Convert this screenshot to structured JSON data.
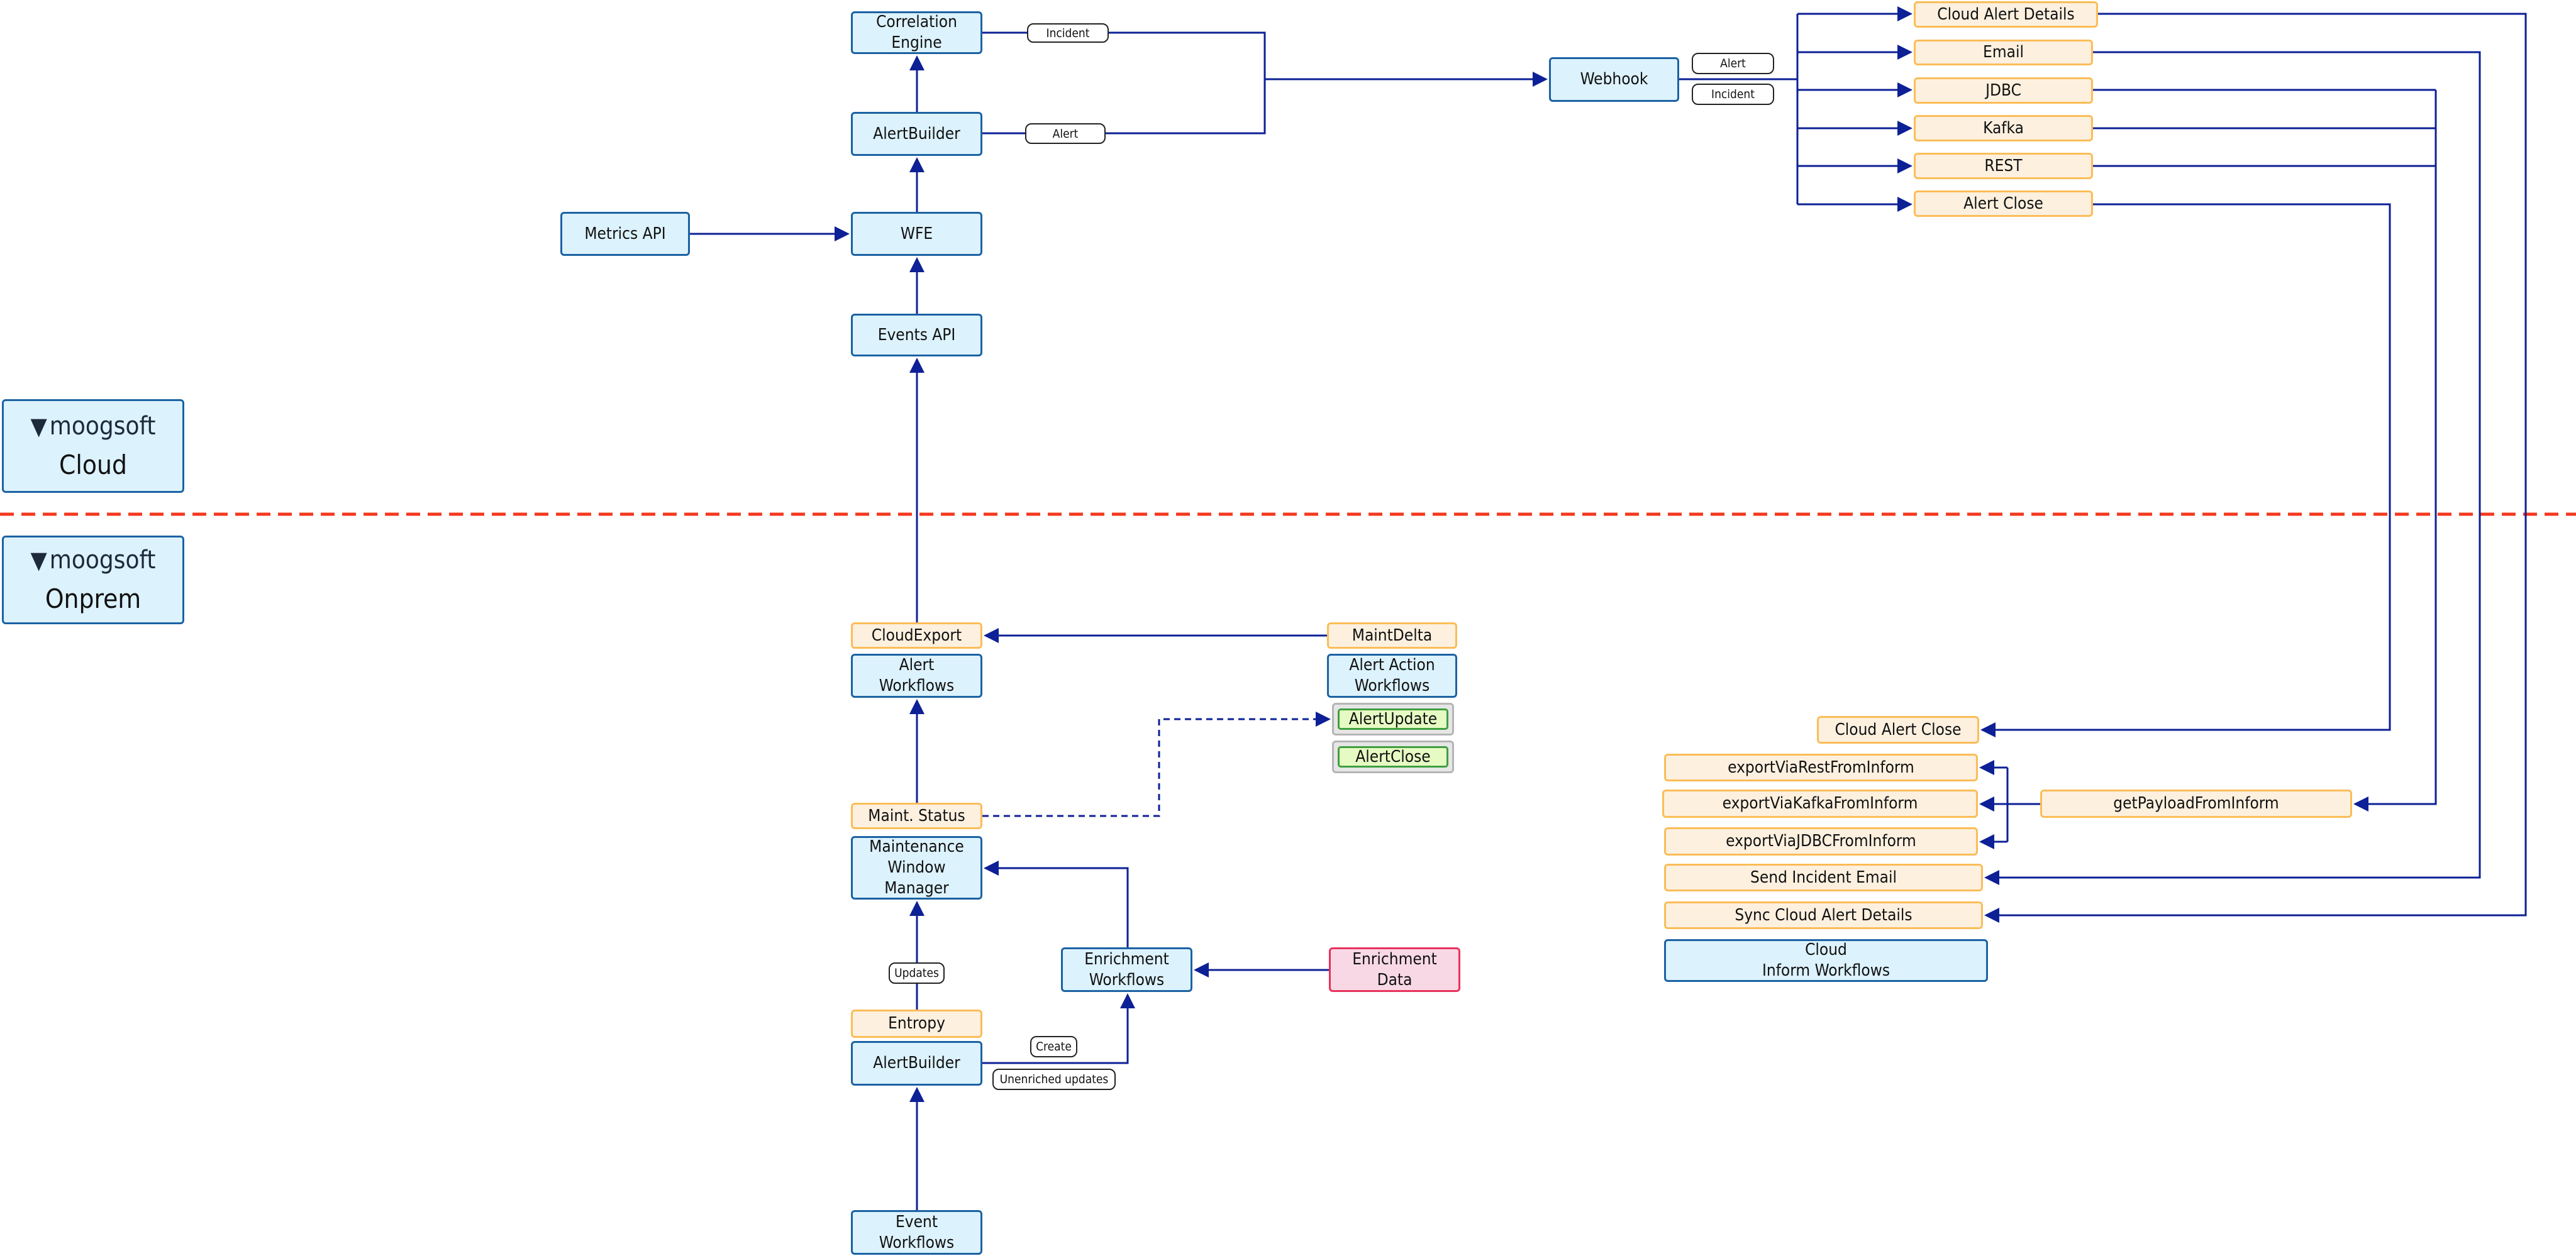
{
  "colors": {
    "line": "#0d2096",
    "divider": "#f4391f",
    "blue_fill": "#dcf2fd",
    "orange_fill": "#fdf0df",
    "pink_fill": "#f9d8e6",
    "green_fill": "#e6fbc3"
  },
  "zones": {
    "cloud": {
      "logo_text": "moogsoft",
      "label": "Cloud",
      "icon": "cow-icon"
    },
    "onprem": {
      "logo_text": "moogsoft",
      "label": "Onprem",
      "icon": "cow-icon"
    }
  },
  "cloud": {
    "correlation_engine": "Correlation\nEngine",
    "alertbuilder": "AlertBuilder",
    "metrics_api": "Metrics API",
    "wfe": "WFE",
    "events_api": "Events API",
    "webhook": "Webhook",
    "labels": {
      "incident": "Incident",
      "alert": "Alert",
      "webhook_alert": "Alert",
      "webhook_incident": "Incident"
    },
    "outputs": [
      "Cloud Alert Details",
      "Email",
      "JDBC",
      "Kafka",
      "REST",
      "Alert Close"
    ]
  },
  "onprem": {
    "cloudexport": "CloudExport",
    "alert_workflows": "Alert\nWorkflows",
    "maintdelta": "MaintDelta",
    "alert_action_workflows": "Alert Action\nWorkflows",
    "alertupdate": "AlertUpdate",
    "alertclose": "AlertClose",
    "maint_status": "Maint. Status",
    "mwm": "Maintenance\nWindow\nManager",
    "updates_label": "Updates",
    "entropy": "Entropy",
    "alertbuilder": "AlertBuilder",
    "create_label": "Create",
    "unenriched_label": "Unenriched updates",
    "enrichment_workflows": "Enrichment\nWorkflows",
    "enrichment_data": "Enrichment\nData",
    "event_workflows": "Event\nWorkflows"
  },
  "inform": {
    "cloud_alert_close": "Cloud Alert Close",
    "export_rest": "exportViaRestFromInform",
    "export_kafka": "exportViaKafkaFromInform",
    "export_jdbc": "exportViaJDBCFromInform",
    "get_payload": "getPayloadFromInform",
    "send_incident_email": "Send Incident Email",
    "sync_cloud_alert_details": "Sync Cloud Alert Details",
    "cloud_inform_workflows": "Cloud\nInform Workflows"
  }
}
